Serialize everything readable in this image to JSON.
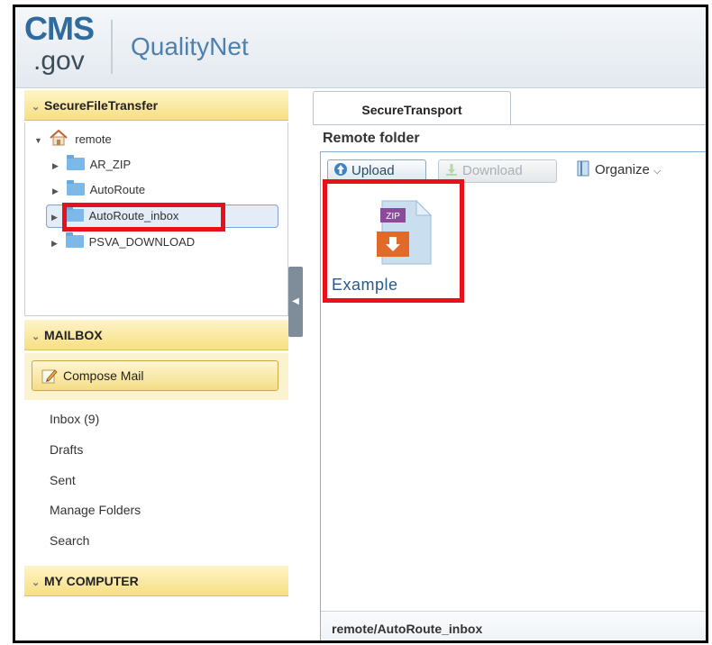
{
  "header": {
    "logo_cms": "CMS",
    "logo_gov": ".gov",
    "logo_product": "QualityNet"
  },
  "sidebar": {
    "secure_file_transfer": {
      "title": "SecureFileTransfer",
      "root": "remote",
      "folders": [
        {
          "label": "AR_ZIP"
        },
        {
          "label": "AutoRoute"
        },
        {
          "label": "AutoRoute_inbox",
          "selected": true
        },
        {
          "label": "PSVA_DOWNLOAD"
        }
      ]
    },
    "mailbox": {
      "title": "MAILBOX",
      "compose_label": "Compose Mail",
      "items": [
        {
          "label": "Inbox (9)"
        },
        {
          "label": "Drafts"
        },
        {
          "label": "Sent"
        },
        {
          "label": "Manage Folders"
        },
        {
          "label": "Search"
        }
      ]
    },
    "my_computer": {
      "title": "MY COMPUTER"
    }
  },
  "main": {
    "tab_label": "SecureTransport",
    "folder_title": "Remote folder",
    "toolbar": {
      "upload_label": "Upload",
      "download_label": "Download",
      "organize_label": "Organize"
    },
    "files": [
      {
        "name": "Example",
        "type_badge": "ZIP"
      }
    ],
    "status_path": "remote/AutoRoute_inbox"
  },
  "colors": {
    "highlight_red": "#e8101a",
    "section_yellow": "#f7df82",
    "accent_blue": "#2f6b9e"
  }
}
